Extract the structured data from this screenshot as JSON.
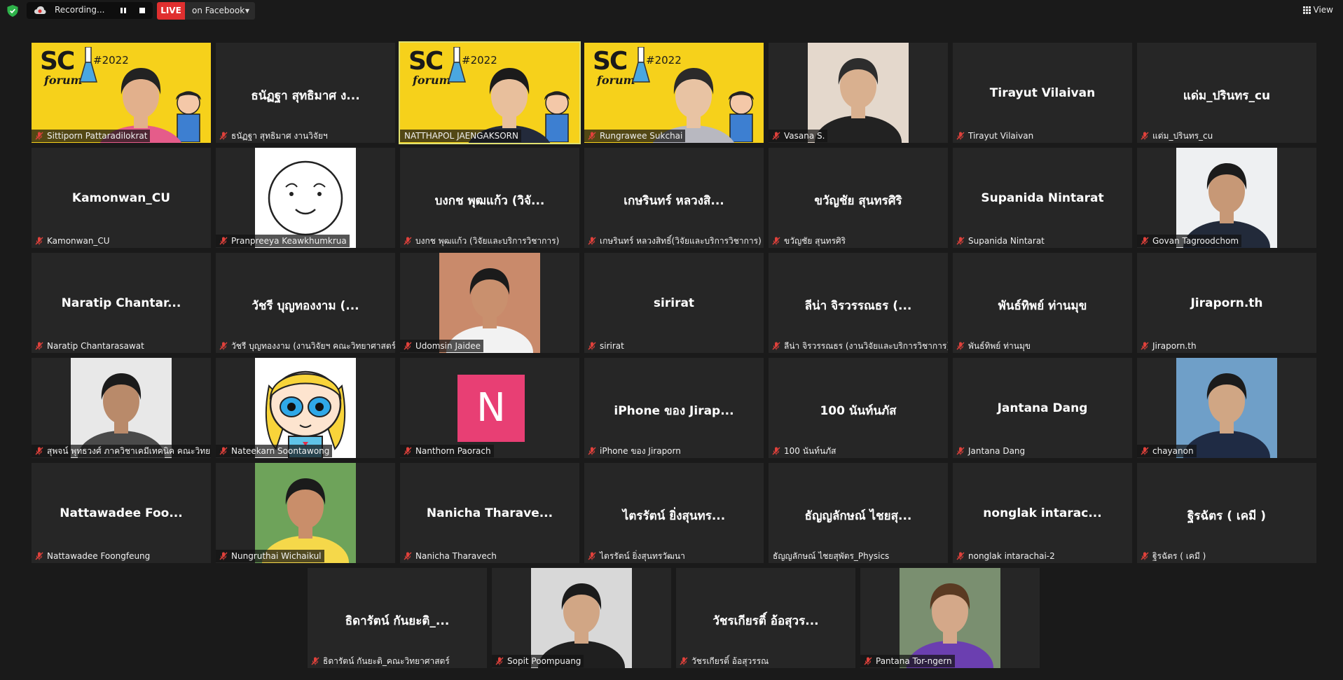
{
  "toolbar": {
    "recording_label": "Recording...",
    "live_label": "LIVE",
    "stream_target": "on Facebook",
    "view_label": "View"
  },
  "banner": {
    "brand": "SC",
    "sub": "forum",
    "year": "#2022"
  },
  "colors": {
    "banner_yellow": "#f6d11b",
    "live_red": "#e02f2f",
    "avatar_pink": "#e83f74",
    "mute_red": "#e0413b"
  },
  "participants": [
    {
      "tag": "Sittiporn Pattaradilokrat",
      "display": "",
      "kind": "banner",
      "muted": true
    },
    {
      "tag": "ธนัฏฐา สุทธิมาศ งานวิจัยฯ",
      "display": "ธนัฏฐา สุทธิมาศ ง...",
      "kind": "name",
      "muted": true
    },
    {
      "tag": "NATTHAPOL JAENGAKSORN",
      "display": "",
      "kind": "banner",
      "muted": false,
      "active": true
    },
    {
      "tag": "Rungrawee Sukchai",
      "display": "",
      "kind": "banner",
      "muted": true
    },
    {
      "tag": "Vasana S.",
      "display": "",
      "kind": "photo",
      "muted": true
    },
    {
      "tag": "Tirayut Vilaivan",
      "display": "Tirayut Vilaivan",
      "kind": "name",
      "muted": true
    },
    {
      "tag": "แด่ม_ปรินทร_cu",
      "display": "แด่ม_ปรินทร_cu",
      "kind": "name",
      "muted": true
    },
    {
      "tag": "Kamonwan_CU",
      "display": "Kamonwan_CU",
      "kind": "name",
      "muted": true
    },
    {
      "tag": "Pranpreeya Keawkhumkrua",
      "display": "",
      "kind": "drawing",
      "muted": true
    },
    {
      "tag": "บงกช พุฒแก้ว (วิจัยและบริการวิชาการ)",
      "display": "บงกช พุฒแก้ว (วิจั...",
      "kind": "name",
      "muted": true
    },
    {
      "tag": "เกษรินทร์ หลวงสิทธิ์(วิจัยและบริการวิชาการ)",
      "display": "เกษรินทร์ หลวงสิ...",
      "kind": "name",
      "muted": true
    },
    {
      "tag": "ขวัญชัย สุนทรศิริ",
      "display": "ขวัญชัย สุนทรศิริ",
      "kind": "name",
      "muted": true
    },
    {
      "tag": "Supanida Nintarat",
      "display": "Supanida Nintarat",
      "kind": "name",
      "muted": true
    },
    {
      "tag": "Govan Tagroodchom",
      "display": "",
      "kind": "photo",
      "muted": true
    },
    {
      "tag": "Naratip Chantarasawat",
      "display": "Naratip Chantar...",
      "kind": "name",
      "muted": true
    },
    {
      "tag": "วัชรี บุญทองงาม (งานวิจัยฯ คณะวิทยาศาสตร์)",
      "display": "วัชรี บุญทองงาม (...",
      "kind": "name",
      "muted": true
    },
    {
      "tag": "Udomsin Jaidee",
      "display": "",
      "kind": "photo",
      "muted": true
    },
    {
      "tag": "sirirat",
      "display": "sirirat",
      "kind": "name",
      "muted": true
    },
    {
      "tag": "ลีน่า จิรวรรณธร (งานวิจัยและบริการวิชาการ)",
      "display": "ลีน่า จิรวรรณธร (...",
      "kind": "name",
      "muted": true
    },
    {
      "tag": "พันธ์ทิพย์ ท่านมุข",
      "display": "พันธ์ทิพย์ ท่านมุข",
      "kind": "name",
      "muted": true
    },
    {
      "tag": "Jiraporn.th",
      "display": "Jiraporn.th",
      "kind": "name",
      "muted": true
    },
    {
      "tag": "สุพจน์ พุทธวงศ์ ภาควิชาเคมีเทคนิค คณะวิทย...",
      "display": "",
      "kind": "photo",
      "muted": true
    },
    {
      "tag": "Nateekarn Soontawong",
      "display": "",
      "kind": "cartoon",
      "muted": true
    },
    {
      "tag": "Nanthorn Paorach",
      "display": "",
      "kind": "avatar",
      "avatar_letter": "N",
      "muted": true
    },
    {
      "tag": "iPhone ของ Jiraporn",
      "display": "iPhone ของ Jirap...",
      "kind": "name",
      "muted": true
    },
    {
      "tag": "100 นันท์นภัส",
      "display": "100 นันท์นภัส",
      "kind": "name",
      "muted": true
    },
    {
      "tag": "Jantana Dang",
      "display": "Jantana Dang",
      "kind": "name",
      "muted": true
    },
    {
      "tag": "chayanon",
      "display": "",
      "kind": "photo",
      "muted": true
    },
    {
      "tag": "Nattawadee Foongfeung",
      "display": "Nattawadee Foo...",
      "kind": "name",
      "muted": true
    },
    {
      "tag": "Nungruthai Wichaikul",
      "display": "",
      "kind": "photo",
      "muted": true
    },
    {
      "tag": "Nanicha Tharavech",
      "display": "Nanicha Tharave...",
      "kind": "name",
      "muted": true
    },
    {
      "tag": "ไตรรัตน์ ยิ่งสุนทรวัฒนา",
      "display": "ไตรรัตน์ ยิ่งสุนทร...",
      "kind": "name",
      "muted": true
    },
    {
      "tag": "ธัญญลักษณ์ ไชยสุพัตร_Physics",
      "display": "ธัญญลักษณ์ ไชยสุ...",
      "kind": "name",
      "muted": false
    },
    {
      "tag": "nonglak intarachai-2",
      "display": "nonglak intarac...",
      "kind": "name",
      "muted": true
    },
    {
      "tag": "ฐิรฉัตร ( เคมี )",
      "display": "ฐิรฉัตร ( เคมี )",
      "kind": "name",
      "muted": true
    },
    {
      "tag": "ธิดารัตน์ กันยะติ_คณะวิทยาศาสตร์",
      "display": "ธิดารัตน์ กันยะติ_...",
      "kind": "name",
      "muted": true
    },
    {
      "tag": "Sopit Poompuang",
      "display": "",
      "kind": "photo",
      "muted": true
    },
    {
      "tag": "วัชรเกียรติ์ อ้อสุวรรณ",
      "display": "วัชรเกียรติ์ อ้อสุวร...",
      "kind": "name",
      "muted": true
    },
    {
      "tag": "Pantana Tor-ngern",
      "display": "",
      "kind": "photo",
      "muted": true
    }
  ]
}
